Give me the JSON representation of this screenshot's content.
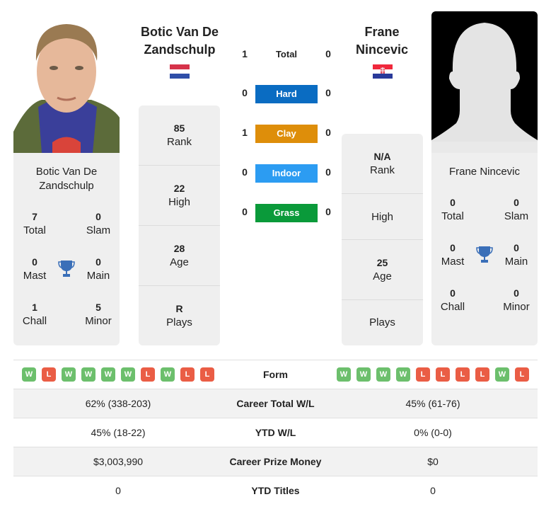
{
  "player1": {
    "name_header": "Botic Van De Zandschulp",
    "name_card": "Botic Van De Zandschulp",
    "country_flag": "netherlands-flag",
    "titles": {
      "total": {
        "value": "7",
        "label": "Total"
      },
      "slam": {
        "value": "0",
        "label": "Slam"
      },
      "mast": {
        "value": "0",
        "label": "Mast"
      },
      "main": {
        "value": "0",
        "label": "Main"
      },
      "chall": {
        "value": "1",
        "label": "Chall"
      },
      "minor": {
        "value": "5",
        "label": "Minor"
      }
    },
    "info": [
      {
        "value": "85",
        "label": "Rank"
      },
      {
        "value": "22",
        "label": "High"
      },
      {
        "value": "28",
        "label": "Age"
      },
      {
        "value": "R",
        "label": "Plays"
      }
    ],
    "form": [
      "W",
      "L",
      "W",
      "W",
      "W",
      "W",
      "L",
      "W",
      "L",
      "L"
    ]
  },
  "player2": {
    "name_header": "Frane Nincevic",
    "name_card": "Frane Nincevic",
    "country_flag": "croatia-flag",
    "titles": {
      "total": {
        "value": "0",
        "label": "Total"
      },
      "slam": {
        "value": "0",
        "label": "Slam"
      },
      "mast": {
        "value": "0",
        "label": "Mast"
      },
      "main": {
        "value": "0",
        "label": "Main"
      },
      "chall": {
        "value": "0",
        "label": "Chall"
      },
      "minor": {
        "value": "0",
        "label": "Minor"
      }
    },
    "info": [
      {
        "value": "N/A",
        "label": "Rank"
      },
      {
        "value": "",
        "label": "High"
      },
      {
        "value": "25",
        "label": "Age"
      },
      {
        "value": "",
        "label": "Plays"
      }
    ],
    "form": [
      "W",
      "W",
      "W",
      "W",
      "L",
      "L",
      "L",
      "L",
      "W",
      "L"
    ]
  },
  "h2h": {
    "total": {
      "label": "Total",
      "p1": "1",
      "p2": "0"
    },
    "surfaces": [
      {
        "label": "Hard",
        "p1": "0",
        "p2": "0",
        "color": "#0a6cc2"
      },
      {
        "label": "Clay",
        "p1": "1",
        "p2": "0",
        "color": "#de8e0a"
      },
      {
        "label": "Indoor",
        "p1": "0",
        "p2": "0",
        "color": "#2c9cf2"
      },
      {
        "label": "Grass",
        "p1": "0",
        "p2": "0",
        "color": "#0a9a3a"
      }
    ]
  },
  "comparison": {
    "form_label": "Form",
    "rows": [
      {
        "label": "Career Total W/L",
        "p1": "62% (338-203)",
        "p2": "45% (61-76)"
      },
      {
        "label": "YTD W/L",
        "p1": "45% (18-22)",
        "p2": "0% (0-0)"
      },
      {
        "label": "Career Prize Money",
        "p1": "$3,003,990",
        "p2": "$0"
      },
      {
        "label": "YTD Titles",
        "p1": "0",
        "p2": "0"
      }
    ]
  },
  "colors": {
    "win": "#6cbf6c",
    "loss": "#ea5d45",
    "trophy": "#3a6fb8"
  }
}
